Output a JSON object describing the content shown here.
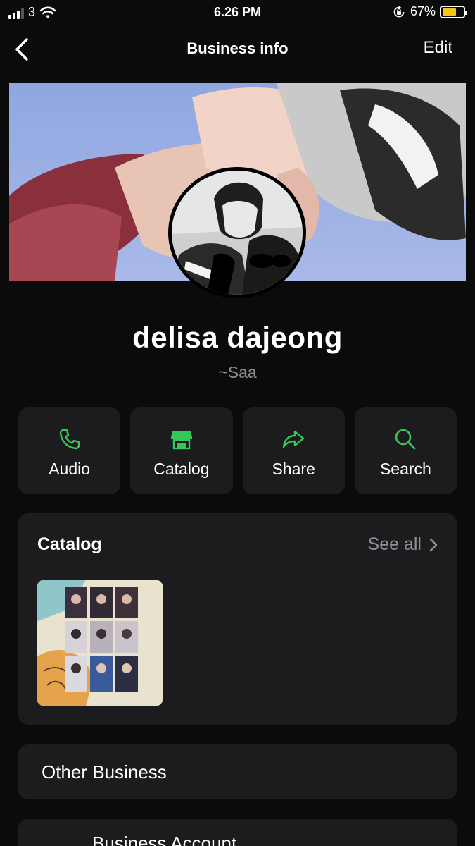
{
  "status_bar": {
    "carrier": "3",
    "time": "6.26 PM",
    "battery_percent": "67%",
    "battery_level": 0.67
  },
  "nav": {
    "title": "Business info",
    "edit_label": "Edit"
  },
  "profile": {
    "name": "delisa dajeong",
    "about": "~Saa"
  },
  "actions": [
    {
      "label": "Audio",
      "icon": "phone-icon"
    },
    {
      "label": "Catalog",
      "icon": "storefront-icon"
    },
    {
      "label": "Share",
      "icon": "share-arrow-icon"
    },
    {
      "label": "Search",
      "icon": "search-icon"
    }
  ],
  "catalog": {
    "title": "Catalog",
    "see_all_label": "See all"
  },
  "rows": {
    "other_business": "Other Business",
    "business_account": "Business Account"
  },
  "colors": {
    "accent_green": "#34c759",
    "card_bg": "#1c1c1e",
    "muted_text": "#8e8e93",
    "battery_yellow": "#f5c518"
  }
}
